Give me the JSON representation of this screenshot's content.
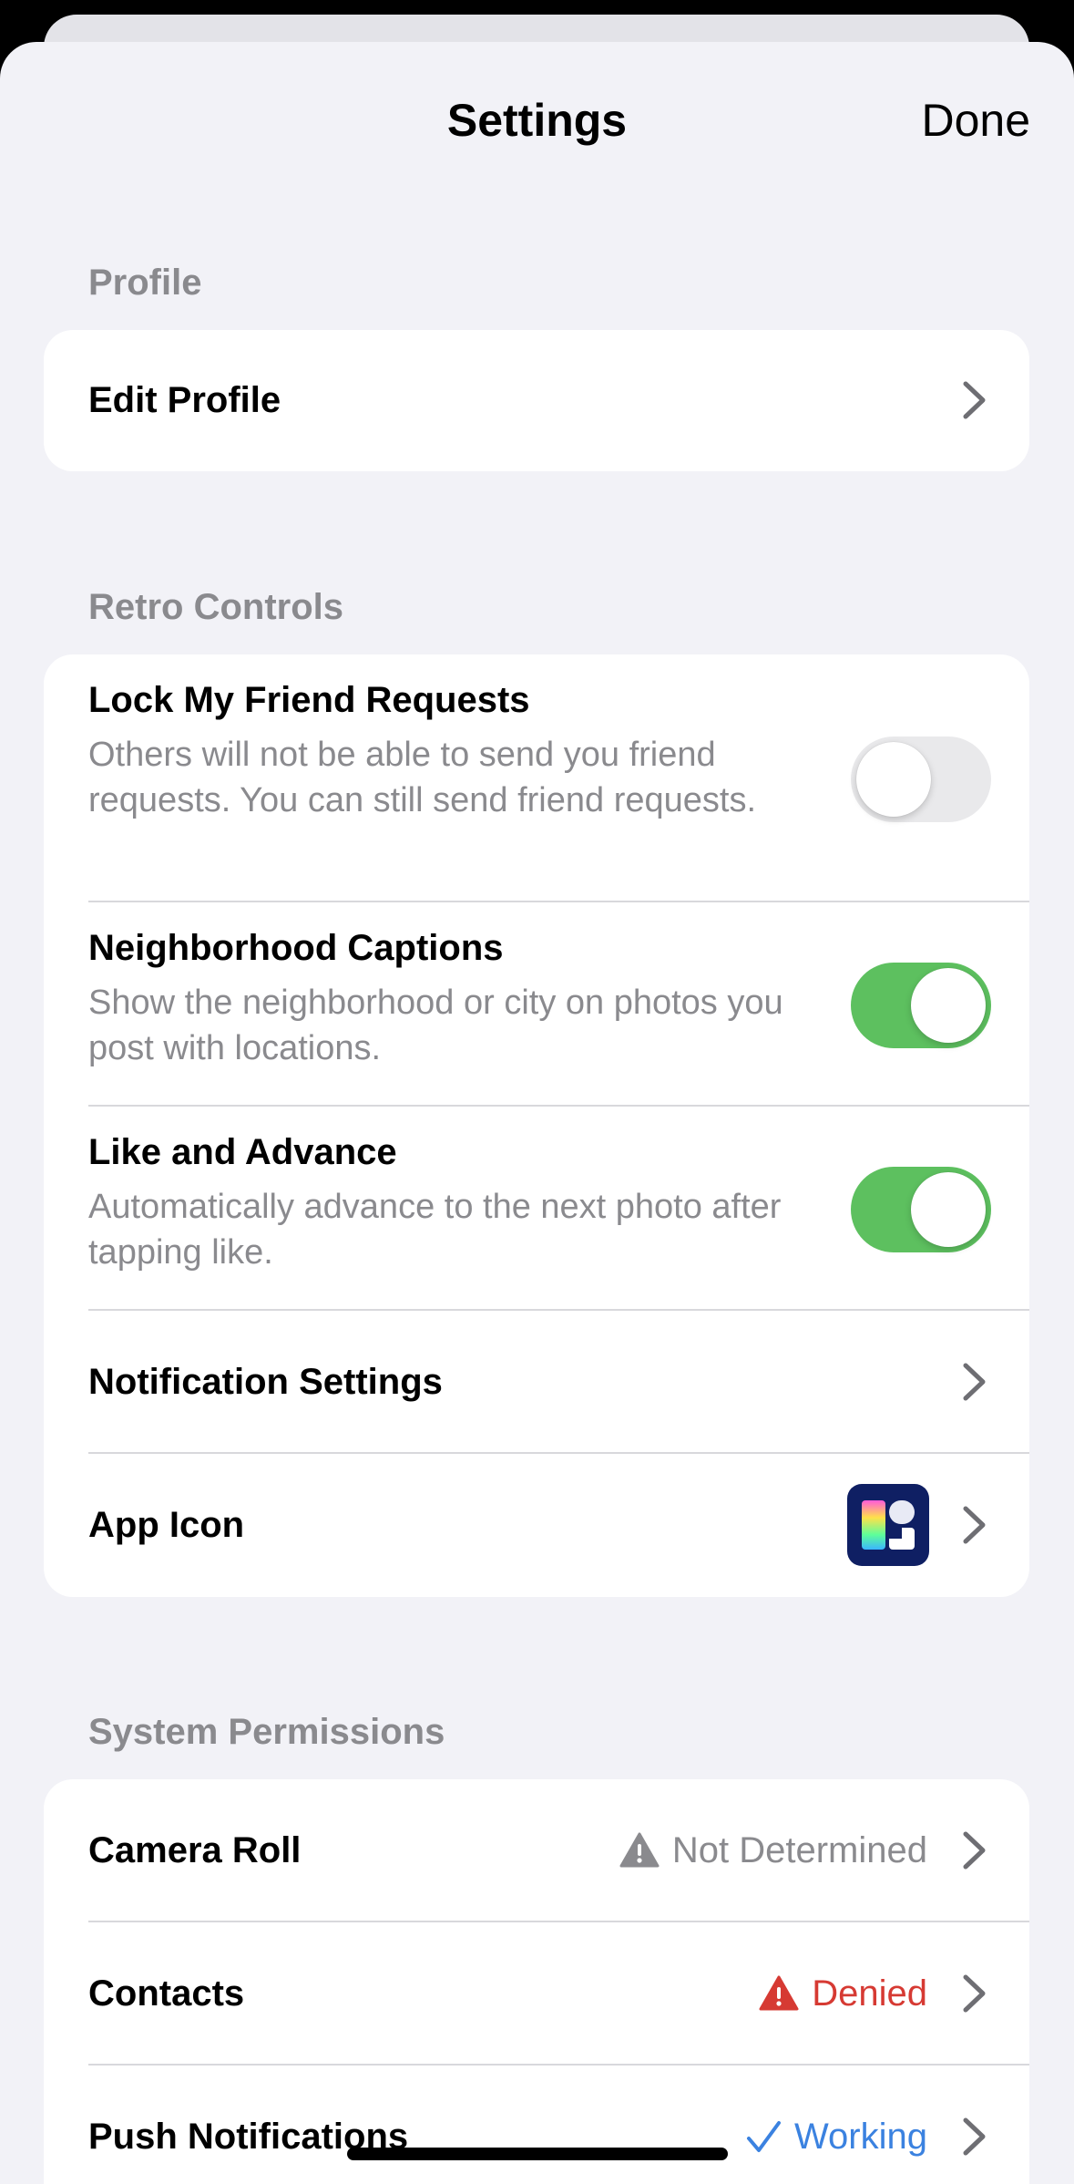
{
  "nav": {
    "title": "Settings",
    "done_label": "Done"
  },
  "sections": {
    "profile": {
      "header": "Profile",
      "edit_profile": "Edit Profile"
    },
    "retro_controls": {
      "header": "Retro Controls",
      "lock_requests": {
        "title": "Lock My Friend Requests",
        "desc": "Others will not be able to send you friend requests. You can still send friend requests.",
        "enabled": false
      },
      "neighborhood_captions": {
        "title": "Neighborhood Captions",
        "desc": "Show the neighborhood or city on photos you post with locations.",
        "enabled": true
      },
      "like_advance": {
        "title": "Like and Advance",
        "desc": "Automatically advance to the next photo after tapping like.",
        "enabled": true
      },
      "notification_settings": "Notification Settings",
      "app_icon": "App Icon"
    },
    "system_permissions": {
      "header": "System Permissions",
      "camera_roll": {
        "title": "Camera Roll",
        "status": "Not Determined",
        "icon": "warning-icon",
        "color": "#8a8a8e"
      },
      "contacts": {
        "title": "Contacts",
        "status": "Denied",
        "icon": "warning-icon",
        "color": "#d63a33"
      },
      "push_notifications": {
        "title": "Push Notifications",
        "status": "Working",
        "icon": "checkmark-icon",
        "color": "#3b82e0"
      }
    }
  },
  "colors": {
    "background": "#f2f2f7",
    "toggle_on": "#5dc05f",
    "toggle_off": "#e9e9eb",
    "secondary_text": "#8a8a8e"
  }
}
